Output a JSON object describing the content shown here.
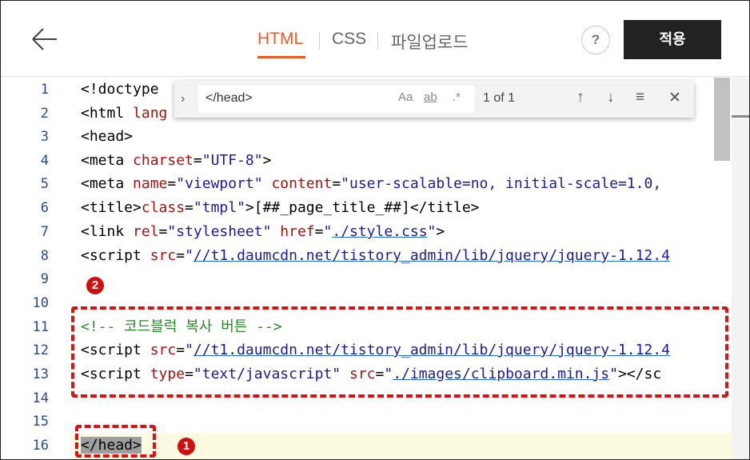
{
  "header": {
    "tabs": [
      {
        "label": "HTML",
        "active": true
      },
      {
        "label": "CSS",
        "active": false
      },
      {
        "label": "파일업로드",
        "active": false
      }
    ],
    "help_label": "?",
    "apply_label": "적용"
  },
  "find_widget": {
    "query": "</head>",
    "match_case_label": "Aa",
    "whole_word_label": "ab",
    "regex_label": ".*",
    "result_count": "1 of 1"
  },
  "editor": {
    "line_numbers": [
      "1",
      "2",
      "3",
      "4",
      "5",
      "6",
      "7",
      "8",
      "9",
      "10",
      "11",
      "12",
      "13",
      "14",
      "15",
      "16"
    ],
    "lines": [
      "<!doctype",
      "<html lang",
      "<head>",
      "<meta charset=\"UTF-8\">",
      "<meta name=\"viewport\" content=\"user-scalable=no, initial-scale=1.0,",
      "<title>[##_page_title_##]</title>",
      "<link rel=\"stylesheet\" href=\"./style.css\">",
      "<script src=\"//t1.daumcdn.net/tistory_admin/lib/jquery/jquery-1.12.4",
      "",
      "",
      "<!-- 코드블럭 복사 버튼 -->",
      "<script src=\"//t1.daumcdn.net/tistory_admin/lib/jquery/jquery-1.12.4",
      "<script type=\"text/javascript\" src=\"./images/clipboard.min.js\"></sc",
      "",
      "",
      "</head>"
    ]
  },
  "annotations": {
    "badge_1": "1",
    "badge_2": "2"
  },
  "colors": {
    "accent": "#ef5a29",
    "annotation_red": "#e01010",
    "apply_button_bg": "#222222",
    "current_line_bg": "#fcfae0"
  }
}
